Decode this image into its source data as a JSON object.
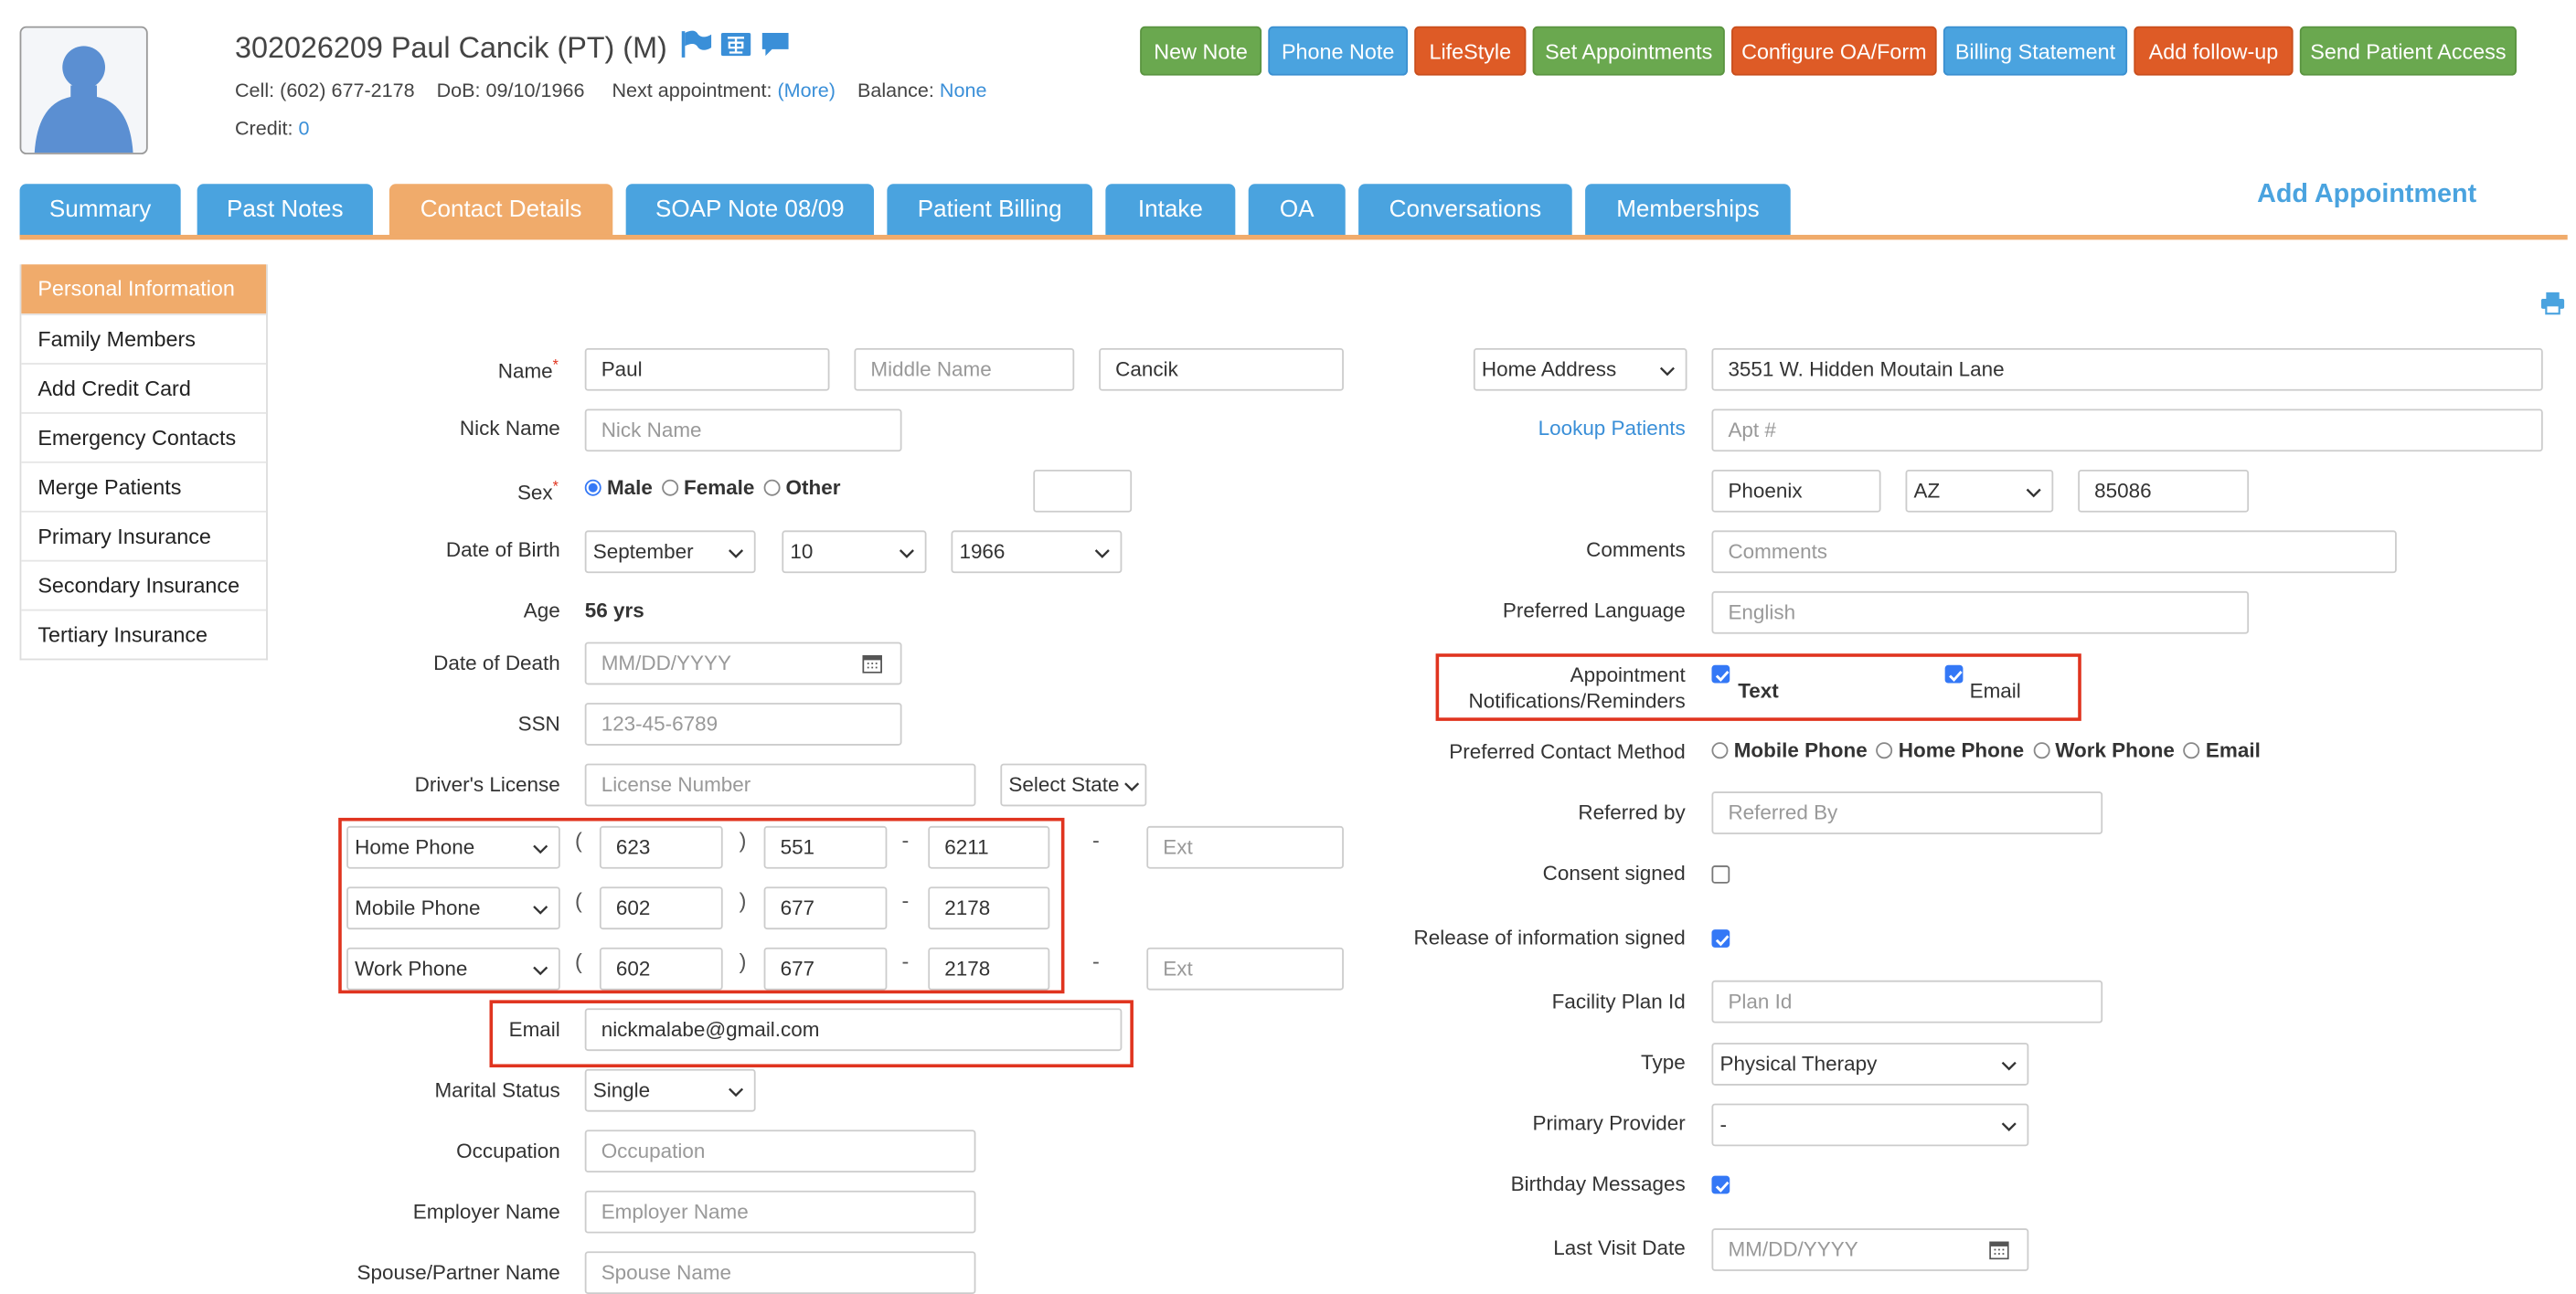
{
  "header": {
    "title": "302026209 Paul Cancik  (PT) (M)",
    "cell_label": "Cell:",
    "cell": "(602) 677-2178",
    "dob_label": "DoB:",
    "dob": "09/10/1966",
    "next_appt_label": "Next appointment:",
    "next_appt_link": "(More)",
    "balance_label": "Balance:",
    "balance": "None",
    "credit_label": "Credit:",
    "credit": "0"
  },
  "actions": [
    {
      "label": "New Note"
    },
    {
      "label": "Phone Note"
    },
    {
      "label": "LifeStyle"
    },
    {
      "label": "Set Appointments"
    },
    {
      "label": "Configure OA/Form"
    },
    {
      "label": "Billing Statement"
    },
    {
      "label": "Add follow-up"
    },
    {
      "label": "Send Patient Access"
    }
  ],
  "tabs": [
    {
      "label": "Summary"
    },
    {
      "label": "Past Notes"
    },
    {
      "label": "Contact Details"
    },
    {
      "label": "SOAP Note 08/09"
    },
    {
      "label": "Patient Billing"
    },
    {
      "label": "Intake"
    },
    {
      "label": "OA"
    },
    {
      "label": "Conversations"
    },
    {
      "label": "Memberships"
    }
  ],
  "active_tab": "Contact Details",
  "add_appointment": "Add Appointment",
  "sidebar": {
    "items": [
      {
        "label": "Personal Information"
      },
      {
        "label": "Family Members"
      },
      {
        "label": "Add Credit Card"
      },
      {
        "label": "Emergency Contacts"
      },
      {
        "label": "Merge Patients"
      },
      {
        "label": "Primary Insurance"
      },
      {
        "label": "Secondary Insurance"
      },
      {
        "label": "Tertiary Insurance"
      }
    ],
    "active": "Personal Information"
  },
  "form_left": {
    "name_label": "Name",
    "first_name": "Paul",
    "middle_placeholder": "Middle Name",
    "last_name": "Cancik",
    "nick_label": "Nick Name",
    "nick_placeholder": "Nick Name",
    "sex_label": "Sex",
    "sex_options": [
      "Male",
      "Female",
      "Other"
    ],
    "sex_selected": "Male",
    "dob_label": "Date of Birth",
    "dob_month": "September",
    "dob_day": "10",
    "dob_year": "1966",
    "age_label": "Age",
    "age": "56 yrs",
    "dod_label": "Date of Death",
    "dod_placeholder": "MM/DD/YYYY",
    "ssn_label": "SSN",
    "ssn_placeholder": "123-45-6789",
    "dl_label": "Driver's License",
    "dl_placeholder": "License Number",
    "dl_state": "Select State",
    "phones": [
      {
        "type": "Home Phone",
        "area": "623",
        "prefix": "551",
        "line": "6211",
        "ext_placeholder": "Ext"
      },
      {
        "type": "Mobile Phone",
        "area": "602",
        "prefix": "677",
        "line": "2178"
      },
      {
        "type": "Work Phone",
        "area": "602",
        "prefix": "677",
        "line": "2178",
        "ext_placeholder": "Ext"
      }
    ],
    "email_label": "Email",
    "email": "nickmalabe@gmail.com",
    "marital_label": "Marital Status",
    "marital": "Single",
    "occupation_label": "Occupation",
    "occupation_placeholder": "Occupation",
    "employer_label": "Employer Name",
    "employer_placeholder": "Employer Name",
    "spouse_label": "Spouse/Partner Name",
    "spouse_placeholder": "Spouse Name"
  },
  "form_right": {
    "address_type": "Home Address",
    "address": "3551 W. Hidden Moutain Lane",
    "lookup_link": "Lookup Patients",
    "apt_placeholder": "Apt #",
    "city": "Phoenix",
    "state": "AZ",
    "zip": "85086",
    "comments_label": "Comments",
    "comments_placeholder": "Comments",
    "lang_label": "Preferred Language",
    "lang_placeholder": "English",
    "notif_label_line1": "Appointment",
    "notif_label_line2": "Notifications/Reminders",
    "notif_text": "Text",
    "notif_email": "Email",
    "contact_label": "Preferred Contact Method",
    "contact_options": [
      "Mobile Phone",
      "Home Phone",
      "Work Phone",
      "Email"
    ],
    "referred_label": "Referred by",
    "referred_placeholder": "Referred By",
    "consent_label": "Consent signed",
    "consent_checked": false,
    "release_label": "Release of information signed",
    "release_checked": true,
    "facility_label": "Facility Plan Id",
    "facility_placeholder": "Plan Id",
    "type_label": "Type",
    "type": "Physical Therapy",
    "provider_label": "Primary Provider",
    "provider": "-",
    "birthday_label": "Birthday Messages",
    "birthday_checked": true,
    "lastvisit_label": "Last Visit Date",
    "lastvisit_placeholder": "MM/DD/YYYY"
  },
  "colors": {
    "accent_blue": "#4aa3df",
    "active_orange": "#f0ab6b",
    "green": "#6aa84f",
    "orange_red": "#de5b26",
    "highlight_red": "#e0341f"
  }
}
